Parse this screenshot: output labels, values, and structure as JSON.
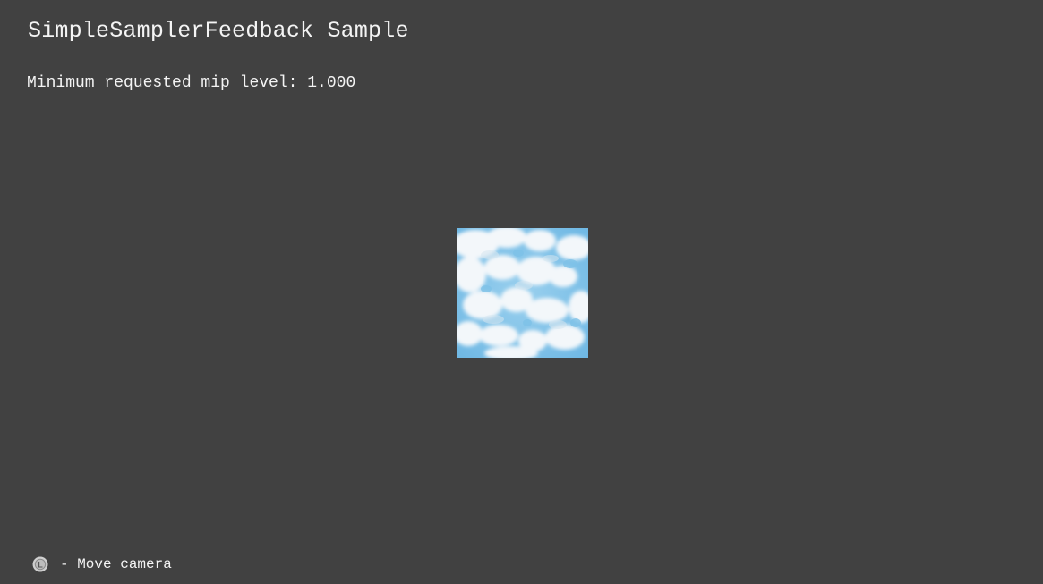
{
  "app": {
    "title": "SimpleSamplerFeedback Sample"
  },
  "hud": {
    "mip_readout": "Minimum requested mip level: 1.000"
  },
  "scene": {
    "texture": {
      "icon": "cloud-texture",
      "sky_color": "#7fc0e6",
      "cloud_color": "#f4f8fb"
    }
  },
  "controls": {
    "legend": [
      {
        "icon": "left-stick-icon",
        "icon_letter": "L",
        "label": "- Move camera"
      }
    ]
  }
}
